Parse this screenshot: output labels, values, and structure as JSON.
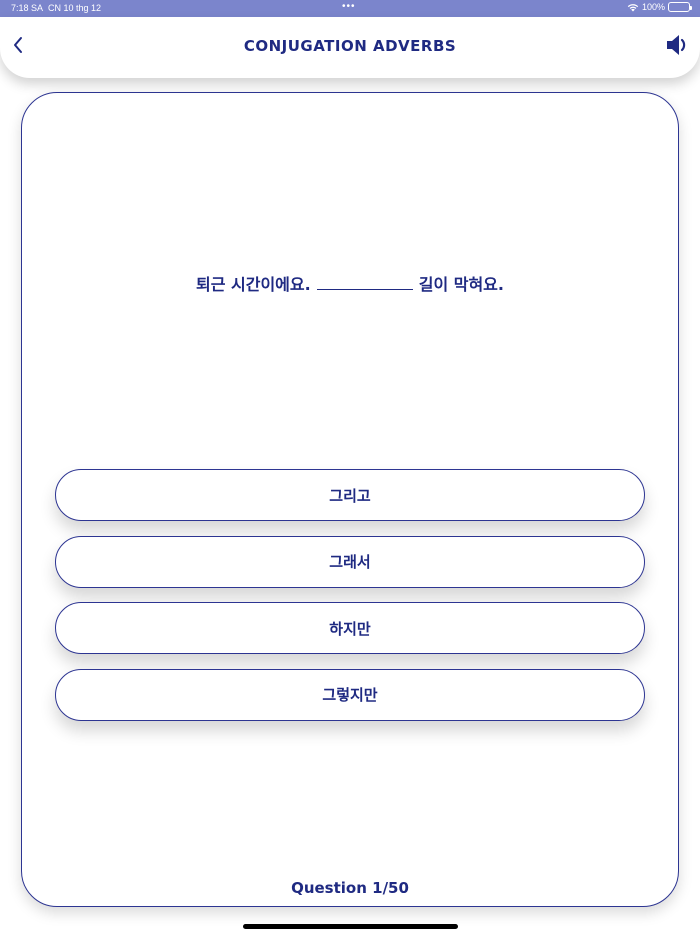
{
  "status_bar": {
    "time": "7:18 SA",
    "date": "CN 10 thg 12",
    "dots": "•••",
    "battery_text": "100%",
    "wifi_icon": "wifi-icon",
    "battery_icon": "battery-icon"
  },
  "nav": {
    "title": "CONJUGATION ADVERBS",
    "back_icon": "chevron-left-icon",
    "speaker_icon": "speaker-icon"
  },
  "question": {
    "before_blank": "퇴근 시간이에요.",
    "after_blank": "길이 막혀요."
  },
  "options": [
    {
      "label": "그리고"
    },
    {
      "label": "그래서"
    },
    {
      "label": "하지만"
    },
    {
      "label": "그렇지만"
    }
  ],
  "progress": {
    "label": "Question 1/50"
  },
  "colors": {
    "accent": "#1f2a82",
    "status_bar": "#7b85cc",
    "border": "#2d3592"
  }
}
